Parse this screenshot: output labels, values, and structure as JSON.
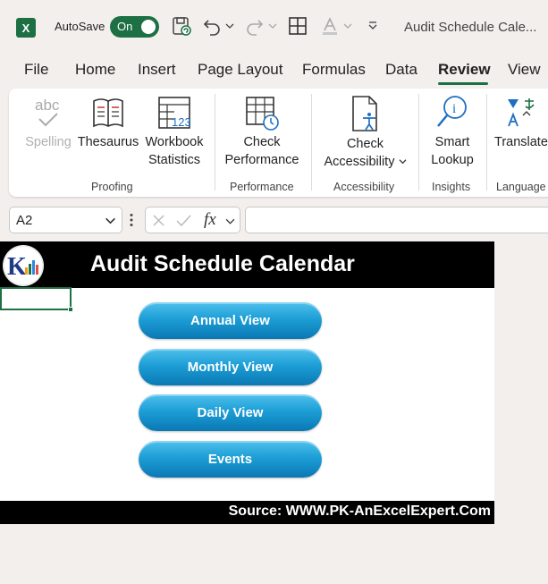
{
  "titlebar": {
    "app_logo": "X",
    "autosave_label": "AutoSave",
    "autosave_state": "On",
    "doc_title": "Audit Schedule Cale...",
    "icons": [
      "save-icon",
      "undo-icon",
      "redo-icon",
      "table-icon",
      "font-color-icon",
      "customize-icon"
    ]
  },
  "tabs": [
    {
      "label": "File"
    },
    {
      "label": "Home"
    },
    {
      "label": "Insert"
    },
    {
      "label": "Page Layout"
    },
    {
      "label": "Formulas"
    },
    {
      "label": "Data"
    },
    {
      "label": "Review",
      "active": true
    },
    {
      "label": "View"
    }
  ],
  "ribbon": {
    "spelling": {
      "icon_text": "abc",
      "label": "Spelling"
    },
    "thesaurus": {
      "label": "Thesaurus"
    },
    "workbook_statistics": {
      "icon_text": "123",
      "line1": "Workbook",
      "line2": "Statistics"
    },
    "check_performance": {
      "line1": "Check",
      "line2": "Performance"
    },
    "check_accessibility": {
      "line1": "Check",
      "line2": "Accessibility"
    },
    "smart_lookup": {
      "icon_text": "i",
      "line1": "Smart",
      "line2": "Lookup"
    },
    "translate": {
      "label": "Translate"
    },
    "groups": {
      "proofing": "Proofing",
      "performance": "Performance",
      "accessibility": "Accessibility",
      "insights": "Insights",
      "language": "Language"
    }
  },
  "formula_bar": {
    "name_box": "A2",
    "fx_label": "fx",
    "formula": ""
  },
  "sheet": {
    "logo_text": "K",
    "title": "Audit Schedule Calendar",
    "buttons": [
      "Annual View",
      "Monthly View",
      "Daily View",
      "Events"
    ],
    "source": "Source: WWW.PK-AnExcelExpert.Com"
  },
  "colors": {
    "excel_green": "#1d7044",
    "button_blue": "#1d9ed6",
    "header_band": "#000000"
  }
}
